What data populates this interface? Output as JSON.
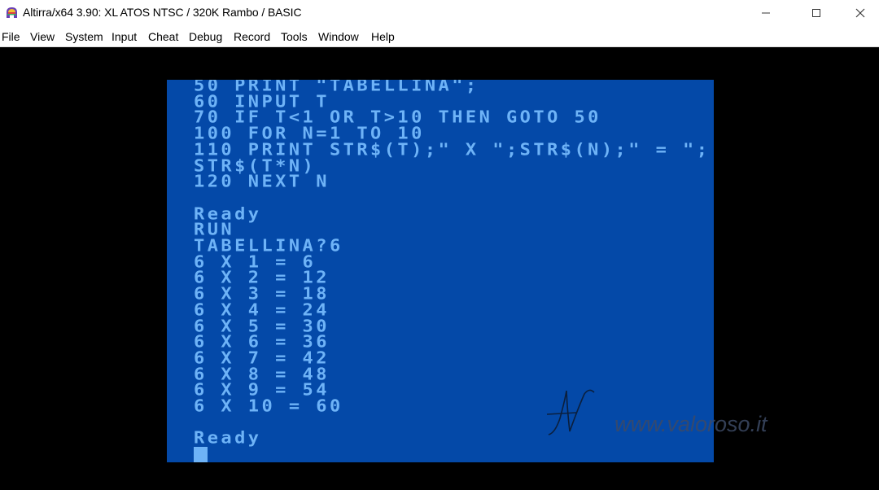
{
  "window": {
    "title": "Altirra/x64 3.90: XL ATOS NTSC / 320K Rambo / BASIC",
    "icon": "altirra-app-icon",
    "controls": {
      "minimize": "minimize-icon",
      "maximize": "maximize-icon",
      "close": "close-icon"
    }
  },
  "menubar": {
    "items": [
      "File",
      "View",
      "System",
      "Input",
      "Cheat",
      "Debug",
      "Record",
      "Tools",
      "Window",
      "Help"
    ]
  },
  "screen": {
    "background_color": "#0449a8",
    "text_color": "#6eb3f7",
    "lines": [
      "50 PRINT \"TABELLINA\";",
      "60 INPUT T",
      "70 IF T<1 OR T>10 THEN GOTO 50",
      "100 FOR N=1 TO 10",
      "110 PRINT STR$(T);\" X \";STR$(N);\" = \";",
      "STR$(T*N)",
      "120 NEXT N",
      "",
      "Ready",
      "RUN",
      "TABELLINA?6",
      "6 X 1 = 6",
      "6 X 2 = 12",
      "6 X 3 = 18",
      "6 X 4 = 24",
      "6 X 5 = 30",
      "6 X 6 = 36",
      "6 X 7 = 42",
      "6 X 8 = 48",
      "6 X 9 = 54",
      "6 X 10 = 60",
      "",
      "Ready"
    ]
  },
  "watermark": {
    "url": "www.valoroso.it"
  }
}
